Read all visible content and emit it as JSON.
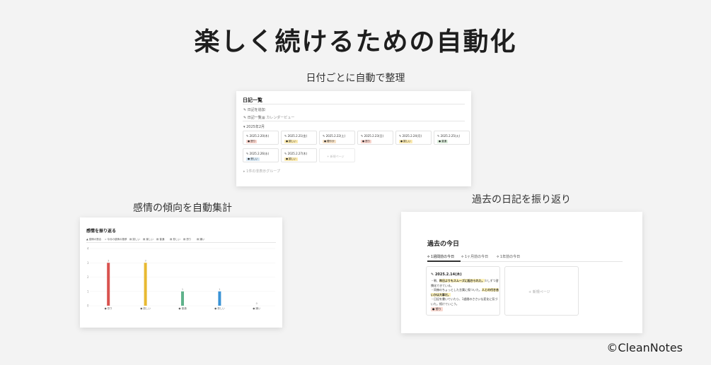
{
  "title": "楽しく続けるための自動化",
  "captions": {
    "auto_sort": "日付ごとに自動で整理",
    "emotion": "感情の傾向を自動集計",
    "look_back": "過去の日記を振り返り"
  },
  "diary": {
    "title": "日記一覧",
    "new_diary": "日記を追加",
    "tabs": [
      "日記一覧",
      "カレンダービュー"
    ],
    "group": "2025年2月",
    "entries": [
      {
        "date": "2025.2.20(木)",
        "tag": "怒り",
        "tag_color": "#f8d4cc"
      },
      {
        "date": "2025.2.21(金)",
        "tag": "嬉しい",
        "tag_color": "#fbeab0"
      },
      {
        "date": "2025.2.22(土)",
        "tag": "穏やか",
        "tag_color": "#f7e2c7"
      },
      {
        "date": "2025.2.23(日)",
        "tag": "怒り",
        "tag_color": "#f8d4cc"
      },
      {
        "date": "2025.2.24(月)",
        "tag": "嬉しい",
        "tag_color": "#fbeab0"
      },
      {
        "date": "2025.2.25(火)",
        "tag": "普通",
        "tag_color": "#dcefdc"
      },
      {
        "date": "2025.2.26(水)",
        "tag": "悲しい",
        "tag_color": "#d7e8f5"
      },
      {
        "date": "2025.2.27(木)",
        "tag": "嬉しい",
        "tag_color": "#fbeab0"
      }
    ],
    "new_page": "新規ページ",
    "hidden_group": "1件の非表示グループ"
  },
  "chart": {
    "title": "感情を振り返る",
    "tabs": [
      "感情の割合",
      "今月の感情の推移",
      "嬉しい",
      "楽しい",
      "普通",
      "悲しい",
      "怒り",
      "嫌い"
    ]
  },
  "chart_data": {
    "type": "bar",
    "categories": [
      "怒り",
      "嬉しい",
      "普通",
      "悲しい",
      "嫌い"
    ],
    "values": [
      3,
      3,
      1,
      1,
      0
    ],
    "colors": [
      "#d9534f",
      "#e8b931",
      "#5fb28b",
      "#3a93d6",
      "#cccccc"
    ],
    "ylim": [
      0,
      4
    ],
    "yticks": [
      "4",
      "3",
      "2",
      "1",
      "0"
    ]
  },
  "past": {
    "title": "過去の今日",
    "tabs": [
      "1週間前の今日",
      "1ヶ月前の今日",
      "1年前の今日"
    ],
    "card": {
      "date": "2025.2.14(木)",
      "line1a": "・朝、",
      "line1b": "昨日よりもスムーズに起きられた。",
      "line1c": "少しずつ習慣化できている。",
      "line2a": "・同僚のちょっとした言葉に傷ついた。",
      "line2b": "人との付き合いかは大事だ。",
      "line3": "・日記を書いていたら、1週間のささいな変化に気づいた。続けていこう。",
      "tag": "怒り"
    },
    "new_page": "新規ページ"
  },
  "copyright": "©CleanNotes"
}
